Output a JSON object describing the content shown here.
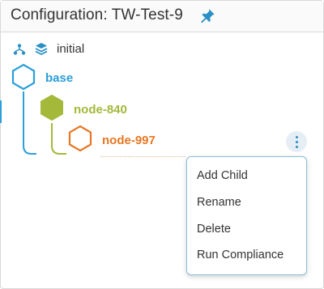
{
  "header": {
    "title": "Configuration: TW-Test-9",
    "pin_icon": "pin-icon"
  },
  "version": {
    "branch_icon": "branch-icon",
    "layers_icon": "layers-icon",
    "label": "initial"
  },
  "tree": {
    "nodes": [
      {
        "label": "base",
        "color": "#2a9fd8",
        "icon": "hexagon-outline-icon"
      },
      {
        "label": "node-840",
        "color": "#a4b83a",
        "icon": "hexagon-filled-icon"
      },
      {
        "label": "node-997",
        "color": "#e87722",
        "icon": "hexagon-outline-icon"
      }
    ]
  },
  "actions": {
    "more_icon": "kebab-vertical-icon"
  },
  "context_menu": {
    "items": [
      "Add Child",
      "Rename",
      "Delete",
      "Run Compliance"
    ]
  }
}
